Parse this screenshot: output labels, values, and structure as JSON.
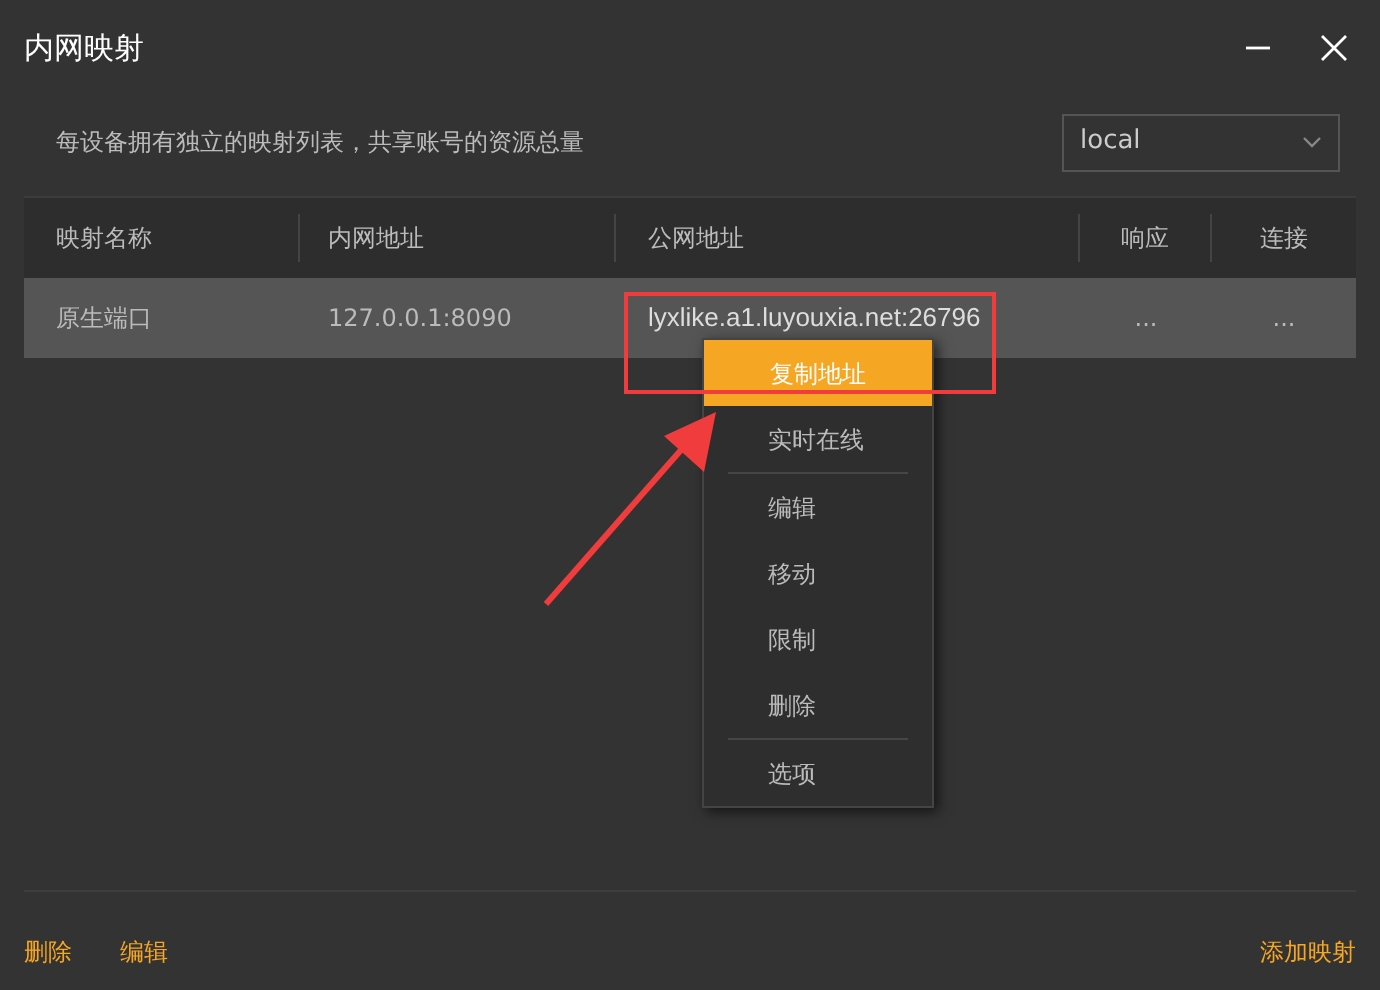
{
  "window": {
    "title": "内网映射"
  },
  "description": "每设备拥有独立的映射列表，共享账号的资源总量",
  "device_select": {
    "value": "local"
  },
  "table": {
    "columns": [
      "映射名称",
      "内网地址",
      "公网地址",
      "响应",
      "连接"
    ],
    "rows": [
      {
        "cells": [
          "原生端口",
          "127.0.0.1:8090",
          "lyxlike.a1.luyouxia.net:26796",
          "...",
          "..."
        ],
        "selected": true
      }
    ]
  },
  "context_menu": {
    "groups": [
      [
        {
          "label": "复制地址",
          "selected": true
        },
        {
          "label": "实时在线",
          "selected": false
        }
      ],
      [
        {
          "label": "编辑",
          "selected": false
        },
        {
          "label": "移动",
          "selected": false
        },
        {
          "label": "限制",
          "selected": false
        },
        {
          "label": "删除",
          "selected": false
        }
      ],
      [
        {
          "label": "选项",
          "selected": false
        }
      ]
    ]
  },
  "footer": {
    "left_links": [
      "删除",
      "编辑"
    ],
    "right_link": "添加映射"
  }
}
